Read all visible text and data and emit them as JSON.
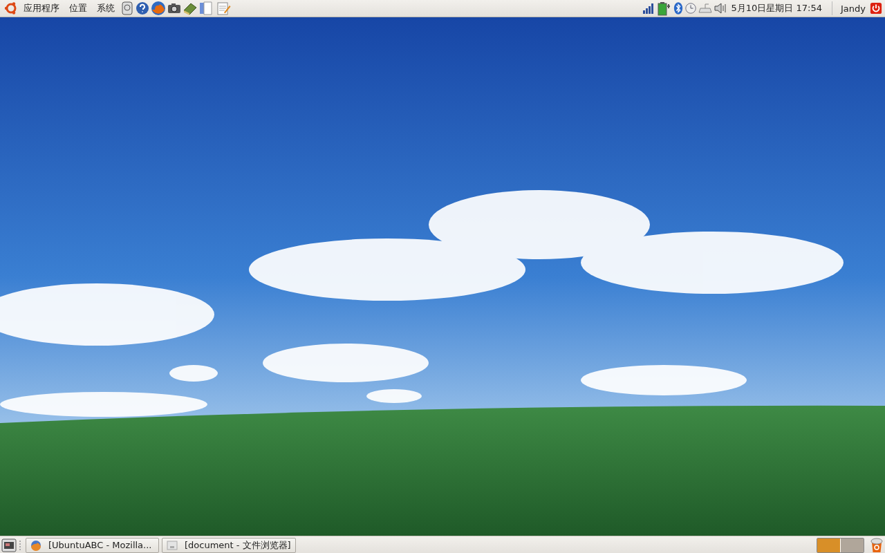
{
  "top_panel": {
    "menus": [
      "应用程序",
      "位置",
      "系统"
    ],
    "clock": "5月10日星期日 17:54",
    "user": "Jandy"
  },
  "taskbar": {
    "windows": [
      {
        "title": "[UbuntuABC - Mozilla...",
        "kind": "browser"
      },
      {
        "title": "[document - 文件浏览器]",
        "kind": "files"
      }
    ],
    "workspaces": [
      {
        "selected": true
      },
      {
        "selected": false
      }
    ]
  }
}
